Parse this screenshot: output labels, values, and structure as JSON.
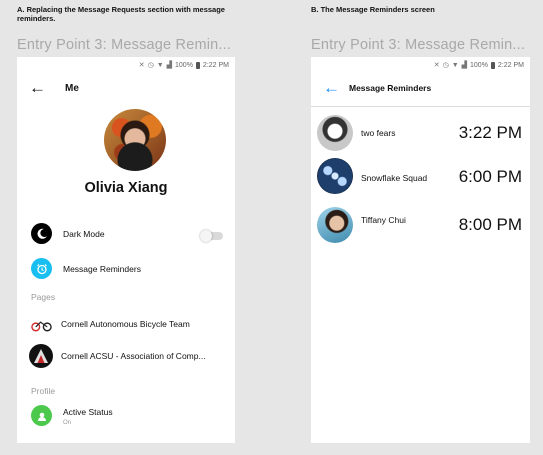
{
  "captions": {
    "a": "A. Replacing the Message Requests section with message reminders.",
    "b": "B. The Message Reminders screen"
  },
  "entry_a": "Entry Point 3: Message Remin...",
  "entry_b": "Entry Point 3: Message Remin...",
  "status_bar": {
    "icons": [
      "mute-icon",
      "alarm-icon",
      "wifi-icon",
      "signal-icon",
      "battery-icon"
    ],
    "battery": "100%",
    "time": "2:22 PM"
  },
  "me_screen": {
    "title": "Me",
    "user_name": "Olivia Xiang",
    "dark_mode_label": "Dark Mode",
    "reminders_label": "Message Reminders",
    "pages_header": "Pages",
    "page1": "Cornell Autonomous Bicycle Team",
    "page2": "Cornell ACSU - Association of Comp...",
    "profile_header": "Profile",
    "active_status_label": "Active Status",
    "active_status_value": "On"
  },
  "reminders_screen": {
    "title": "Message Reminders",
    "items": [
      {
        "name": "two fears",
        "time": "3:22 PM"
      },
      {
        "name": "Snowflake Squad",
        "time": "6:00 PM"
      },
      {
        "name": "Tiffany Chui",
        "time": "8:00 PM"
      }
    ]
  },
  "colors": {
    "accent_blue": "#1a8cff",
    "reminder_icon_bg": "#18bff0",
    "active_status_bg": "#4cc94c",
    "page_bg": "#e6e6e6"
  }
}
